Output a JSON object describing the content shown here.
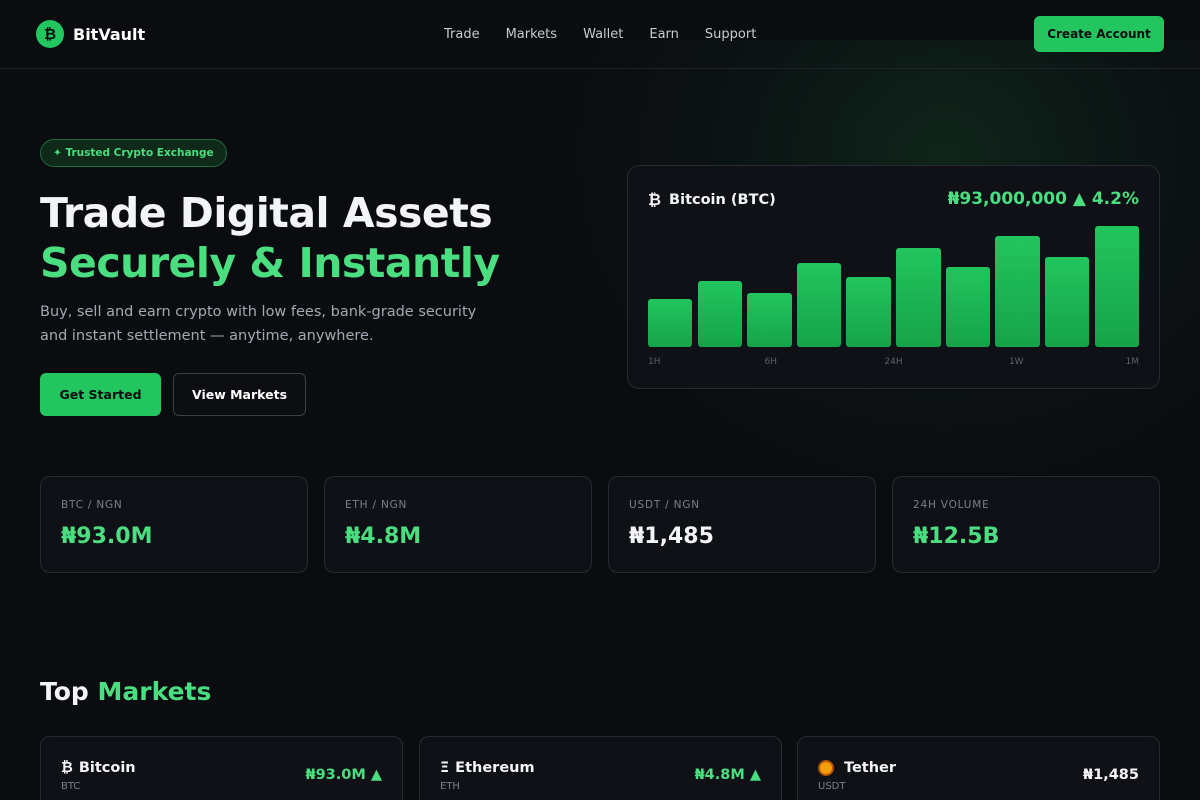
{
  "brand": {
    "name": "BitVault",
    "logo_glyph": "₿"
  },
  "nav": {
    "items": [
      {
        "label": "Trade"
      },
      {
        "label": "Markets"
      },
      {
        "label": "Wallet"
      },
      {
        "label": "Earn"
      },
      {
        "label": "Support"
      }
    ],
    "cta_label": "Create Account"
  },
  "hero": {
    "badge": "✦ Trusted Crypto Exchange",
    "title_line1": "Trade Digital Assets",
    "title_line2": "Securely & Instantly",
    "subtitle": "Buy, sell and earn crypto with low fees, bank-grade security and instant settlement — anytime, anywhere.",
    "primary_button": "Get Started",
    "secondary_button": "View Markets"
  },
  "chart_card": {
    "coin_glyph": "₿",
    "coin_name": "Bitcoin (BTC)",
    "price": "₦93,000,000 ▲ 4.2%"
  },
  "chart_data": {
    "type": "bar",
    "title": "",
    "xlabel": "",
    "ylabel": "",
    "tick_labels": [
      "1H",
      "6H",
      "24H",
      "1W",
      "1M"
    ],
    "values": [
      40,
      55,
      45,
      70,
      58,
      82,
      66,
      92,
      75,
      100
    ],
    "ylim": [
      0,
      100
    ],
    "grid": false
  },
  "stats": [
    {
      "label": "BTC / NGN",
      "value": "₦93.0M"
    },
    {
      "label": "ETH / NGN",
      "value": "₦4.8M"
    },
    {
      "label": "USDT / NGN",
      "value": "₦1,485"
    },
    {
      "label": "24H VOLUME",
      "value": "₦12.5B"
    }
  ],
  "top_markets": {
    "title_plain": "Top",
    "title_accent": "Markets",
    "items": [
      {
        "glyph": "₿",
        "name": "Bitcoin",
        "symbol": "BTC",
        "price": "₦93.0M ▲"
      },
      {
        "glyph": "Ξ",
        "name": "Ethereum",
        "symbol": "ETH",
        "price": "₦4.8M ▲"
      },
      {
        "glyph": "",
        "name": "Tether",
        "symbol": "USDT",
        "price": "₦1,485"
      }
    ]
  },
  "colors": {
    "accent": "#22c55e",
    "accent_text": "#4ade80",
    "background": "#0b0c10",
    "card": "#0f1116"
  }
}
